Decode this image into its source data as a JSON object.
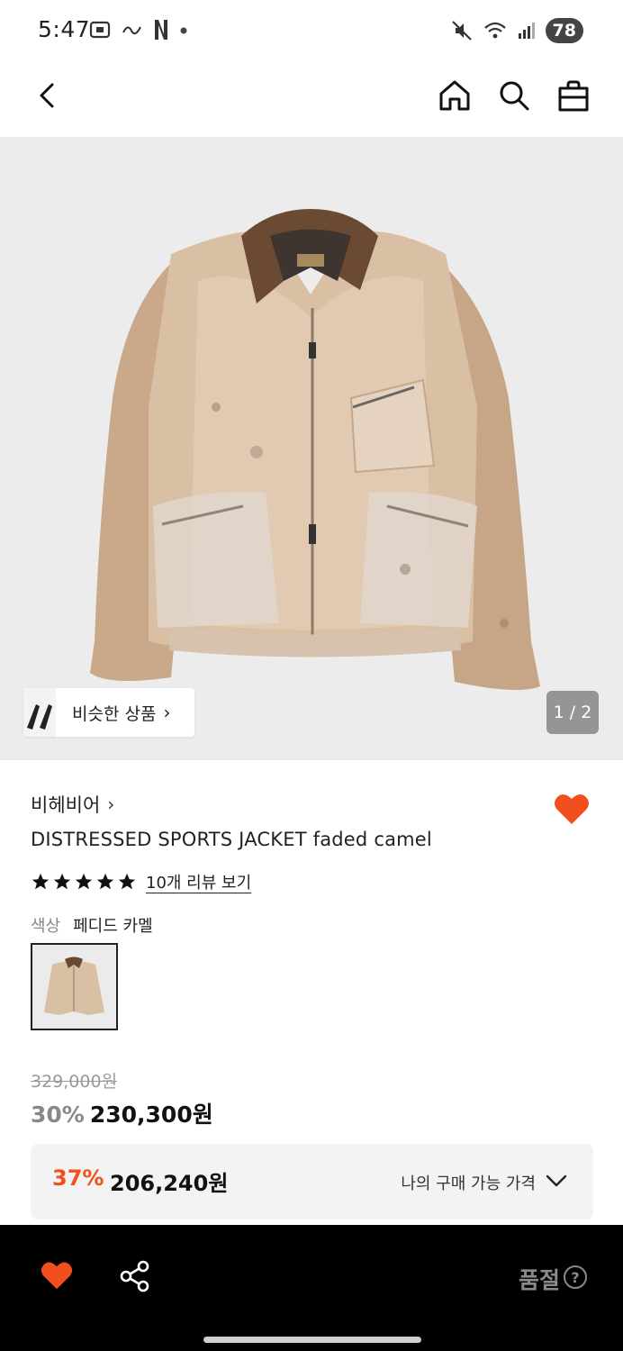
{
  "status_bar": {
    "time": "5:47",
    "battery": "78",
    "left_icons": [
      "screen-record-icon",
      "app-notification-icon",
      "netflix-icon",
      "dot-icon"
    ],
    "right_icons": [
      "mute-icon",
      "wifi-icon",
      "signal-icon"
    ]
  },
  "nav": {
    "back_icon": "chevron-left-icon",
    "home_icon": "home-icon",
    "search_icon": "search-icon",
    "bag_icon": "shopping-bag-icon"
  },
  "gallery": {
    "similar_label": "비슷한 상품",
    "similar_chevron": "›",
    "page_indicator": "1 / 2"
  },
  "product": {
    "brand": "비헤비어",
    "brand_chevron": "›",
    "title": "DISTRESSED SPORTS JACKET faded camel",
    "rating_stars": 5,
    "review_link": "10개 리뷰 보기",
    "color_label": "색상",
    "color_value": "페디드 카멜"
  },
  "pricing": {
    "original_price": "329,000원",
    "discount_rate": "30%",
    "sale_price": "230,300원",
    "best_discount_rate": "37%",
    "best_price": "206,240원",
    "best_price_label": "나의 구매 가능 가격"
  },
  "bottom_bar": {
    "soldout_label": "품절",
    "help_glyph": "?"
  },
  "colors": {
    "accent": "#f24f1e",
    "heart": "#f24f1e",
    "bottom_bar_bg": "#000000"
  }
}
